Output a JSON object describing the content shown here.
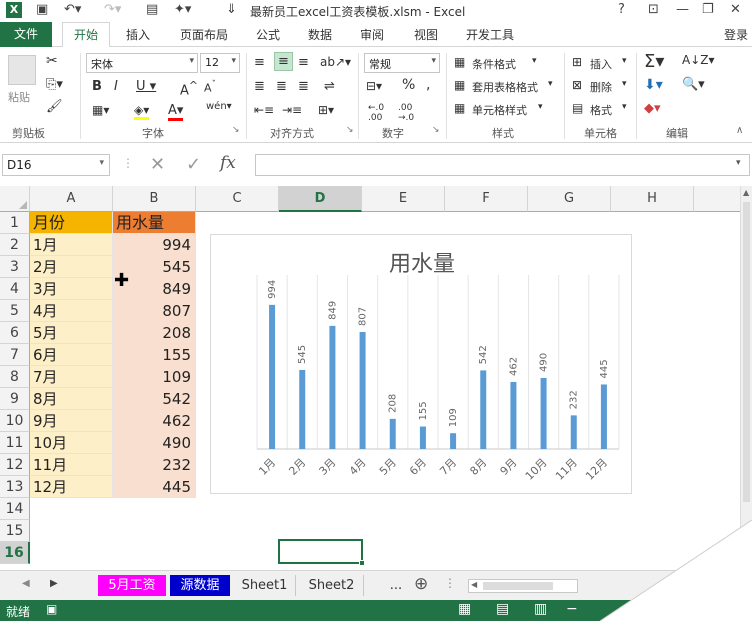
{
  "window": {
    "title": "最新员工excel工资表模板.xlsm - Excel",
    "login": "登录"
  },
  "menu": {
    "file": "文件",
    "tabs": [
      "开始",
      "插入",
      "页面布局",
      "公式",
      "数据",
      "审阅",
      "视图",
      "开发工具"
    ]
  },
  "ribbon": {
    "paste": "粘贴",
    "font_name": "宋体",
    "font_size": "12",
    "number_format": "常规",
    "percent": "%",
    "comma": ",",
    "cond_format": "条件格式",
    "table_format": "套用表格格式",
    "cell_style": "单元格样式",
    "insert": "插入",
    "delete": "删除",
    "format": "格式",
    "groups": [
      "剪贴板",
      "字体",
      "对齐方式",
      "数字",
      "样式",
      "单元格",
      "编辑"
    ]
  },
  "formula": {
    "namebox": "D16",
    "fx": "fx"
  },
  "columns": [
    "A",
    "B",
    "C",
    "D",
    "E",
    "F",
    "G",
    "H"
  ],
  "rows": [
    "1",
    "2",
    "3",
    "4",
    "5",
    "6",
    "7",
    "8",
    "9",
    "10",
    "11",
    "12",
    "13",
    "14",
    "15",
    "16"
  ],
  "table": {
    "header": [
      "月份",
      "用水量"
    ],
    "data": [
      [
        "1月",
        "994"
      ],
      [
        "2月",
        "545"
      ],
      [
        "3月",
        "849"
      ],
      [
        "4月",
        "807"
      ],
      [
        "5月",
        "208"
      ],
      [
        "6月",
        "155"
      ],
      [
        "7月",
        "109"
      ],
      [
        "8月",
        "542"
      ],
      [
        "9月",
        "462"
      ],
      [
        "10月",
        "490"
      ],
      [
        "11月",
        "232"
      ],
      [
        "12月",
        "445"
      ]
    ]
  },
  "chart_data": {
    "type": "bar",
    "title": "用水量",
    "categories": [
      "1月",
      "2月",
      "3月",
      "4月",
      "5月",
      "6月",
      "7月",
      "8月",
      "9月",
      "10月",
      "11月",
      "12月"
    ],
    "values": [
      994,
      545,
      849,
      807,
      208,
      155,
      109,
      542,
      462,
      490,
      232,
      445
    ],
    "ylim": [
      0,
      1200
    ],
    "grid": true,
    "color": "#5b9bd5"
  },
  "sheet_tabs": [
    "5月工资",
    "源数据",
    "Sheet1",
    "Sheet2",
    "..."
  ],
  "status": {
    "ready": "就绪"
  },
  "colors": {
    "header_a": "#f4b400",
    "header_b": "#ed7d31",
    "col_a_fill": "#fdf0c8",
    "col_b_fill": "#f9dfd0",
    "accent": "#217346"
  }
}
